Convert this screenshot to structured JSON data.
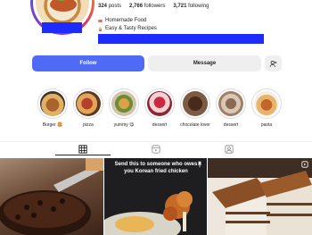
{
  "profile": {
    "stats": {
      "posts_count": "324",
      "posts_label": "posts",
      "followers_count": "2,766",
      "followers_label": "followers",
      "following_count": "3,721",
      "following_label": "following"
    },
    "bio_lines": [
      "Homemade Food",
      "Easy & Tasty Recipes"
    ]
  },
  "actions": {
    "follow_label": "Follow",
    "message_label": "Message",
    "add_user_icon": "add-user-icon"
  },
  "highlights": [
    {
      "label": "Burger 🍔"
    },
    {
      "label": "pizza"
    },
    {
      "label": "yummy 😋"
    },
    {
      "label": "dessert"
    },
    {
      "label": "chocolate lover"
    },
    {
      "label": "dessert"
    },
    {
      "label": "pasta"
    }
  ],
  "tabs": [
    {
      "icon": "grid-icon",
      "active": true
    },
    {
      "icon": "reels-icon",
      "active": false
    },
    {
      "icon": "tagged-icon",
      "active": false
    }
  ],
  "grid": {
    "tile2_caption": "Send this to someone who owes you Korean fried chicken"
  },
  "colors": {
    "follow_blue": "#4f6bf5",
    "redaction_blue": "#1d2bff",
    "button_gray": "#efefef"
  }
}
